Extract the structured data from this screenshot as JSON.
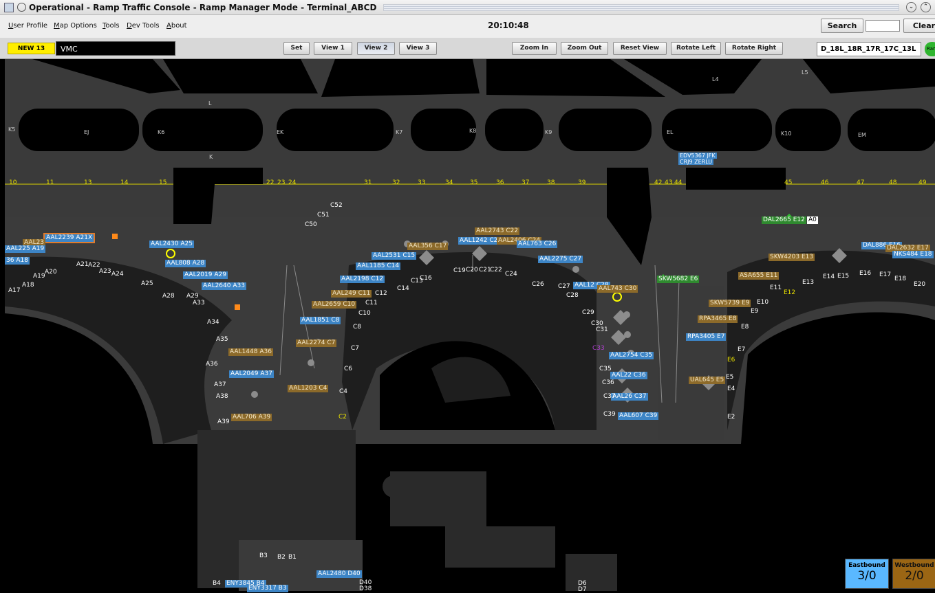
{
  "window": {
    "title": "Operational - Ramp Traffic Console - Ramp Manager Mode - Terminal_ABCD"
  },
  "menu": {
    "items": [
      "User Profile",
      "Map Options",
      "Tools",
      "Dev Tools",
      "About"
    ]
  },
  "clock": "20:10:48",
  "search": {
    "button": "Search",
    "value": "",
    "clear": "Clear"
  },
  "toolbar": {
    "new_badge": "NEW 13",
    "weather": "VMC",
    "view_buttons": [
      "Set",
      "View 1",
      "View 2",
      "View 3"
    ],
    "active_view": "View 2",
    "zoom_buttons": [
      "Zoom In",
      "Zoom Out",
      "Reset View",
      "Rotate Left",
      "Rotate Right"
    ],
    "runway_config": "D_18L_18R_17R_17C_13L",
    "ramp_indicator": "Ram"
  },
  "colors": {
    "blue_tag": "#3d85c6",
    "tan_tag": "#8c6a2a",
    "green_tag": "#2f8a2f",
    "runway_yellow": "#e8e000",
    "selection": "#e07b2b"
  },
  "map": {
    "taxiway_labels": [
      "K5",
      "EJ",
      "K6",
      "EK",
      "K7",
      "K8",
      "K9",
      "EL",
      "K10",
      "EM",
      "L",
      "K",
      "L4",
      "L5"
    ],
    "runway_numbers": [
      "10",
      "11",
      "13",
      "14",
      "15",
      "22",
      "23",
      "24",
      "31",
      "32",
      "33",
      "34",
      "35",
      "36",
      "37",
      "38",
      "39",
      "42",
      "43",
      "44",
      "45",
      "46",
      "47",
      "48",
      "49"
    ],
    "flight_tags": [
      {
        "text": "AAL2239 A21X",
        "color": "blue"
      },
      {
        "text": "AAL23",
        "color": "tan"
      },
      {
        "text": "AAL225 A19",
        "color": "blue"
      },
      {
        "text": "36 A18",
        "color": "blue"
      },
      {
        "text": "AAL2430 A25",
        "color": "blue"
      },
      {
        "text": "AAL808 A28",
        "color": "blue"
      },
      {
        "text": "AAL2019 A29",
        "color": "blue"
      },
      {
        "text": "AAL2640 A33",
        "color": "blue"
      },
      {
        "text": "AAL1448 A36",
        "color": "tan"
      },
      {
        "text": "AAL2049 A37",
        "color": "blue"
      },
      {
        "text": "AAL706 A39",
        "color": "tan"
      },
      {
        "text": "AAL2743 C22",
        "color": "tan"
      },
      {
        "text": "AAL1242 C21",
        "color": "blue"
      },
      {
        "text": "AAL2406 C24",
        "color": "tan"
      },
      {
        "text": "AAL763 C26",
        "color": "blue"
      },
      {
        "text": "AAL356 C17",
        "color": "tan"
      },
      {
        "text": "AAL2531 C15",
        "color": "blue"
      },
      {
        "text": "AAL1185 C14",
        "color": "blue"
      },
      {
        "text": "AAL2198 C12",
        "color": "blue"
      },
      {
        "text": "AAL249 C11",
        "color": "tan"
      },
      {
        "text": "AAL2659 C10",
        "color": "tan"
      },
      {
        "text": "AAL1851 C8",
        "color": "blue"
      },
      {
        "text": "AAL2274 C7",
        "color": "tan"
      },
      {
        "text": "AAL1203 C4",
        "color": "tan"
      },
      {
        "text": "AAL2275 C27",
        "color": "blue"
      },
      {
        "text": "AAL12 C28",
        "color": "blue"
      },
      {
        "text": "AAL743 C30",
        "color": "tan"
      },
      {
        "text": "AAL2754 C35",
        "color": "blue"
      },
      {
        "text": "AAL22 C36",
        "color": "blue"
      },
      {
        "text": "AAL26 C37",
        "color": "blue"
      },
      {
        "text": "AAL607 C39",
        "color": "blue"
      },
      {
        "text": "DAL2665 E12",
        "color": "green"
      },
      {
        "text": "SKW5682 E6",
        "color": "green"
      },
      {
        "text": "DAL886 E16",
        "color": "blue"
      },
      {
        "text": "DAL2632 E17",
        "color": "tan"
      },
      {
        "text": "NKS484 E18",
        "color": "blue"
      },
      {
        "text": "SKW4203 E13",
        "color": "tan"
      },
      {
        "text": "ASA655 E11",
        "color": "tan"
      },
      {
        "text": "SKW5739 E9",
        "color": "tan"
      },
      {
        "text": "RPA3465 E8",
        "color": "tan"
      },
      {
        "text": "RPA3405 E7",
        "color": "blue"
      },
      {
        "text": "UAL645 E5",
        "color": "tan"
      },
      {
        "text": "ENY3845 B4",
        "color": "blue"
      },
      {
        "text": "ENY3317 B3",
        "color": "blue"
      },
      {
        "text": "AAL2480 D40",
        "color": "blue"
      }
    ],
    "gates": [
      "A17",
      "A18",
      "A19",
      "A20",
      "A21",
      "A22",
      "A23",
      "A24",
      "A25",
      "A28",
      "A29",
      "A33",
      "A34",
      "A35",
      "A36",
      "A37",
      "A38",
      "A39",
      "C52",
      "C51",
      "C50",
      "C16",
      "C19",
      "C20",
      "C21",
      "C22",
      "C24",
      "C26",
      "C27",
      "C28",
      "C29",
      "C30",
      "C31",
      "C33",
      "C35",
      "C36",
      "C37",
      "C39",
      "C14",
      "C13",
      "C12",
      "C11",
      "C10",
      "C8",
      "C7",
      "C6",
      "C4",
      "C2",
      "E2",
      "E4",
      "E5",
      "E6",
      "E7",
      "E8",
      "E9",
      "E10",
      "E11",
      "E12",
      "E13",
      "E14",
      "E15",
      "E16",
      "E17",
      "E18",
      "E20",
      "B1",
      "B2",
      "B3",
      "B4",
      "D40",
      "D38",
      "D6",
      "D7"
    ],
    "arrival_box": {
      "line1": "EDV5367 JFK",
      "line2": "CRJ9 ZERLU"
    },
    "small_label": "A0"
  },
  "counters": {
    "eastbound": {
      "label": "Eastbound",
      "value": "3/0"
    },
    "westbound": {
      "label": "Westbound",
      "value": "2/0"
    }
  }
}
